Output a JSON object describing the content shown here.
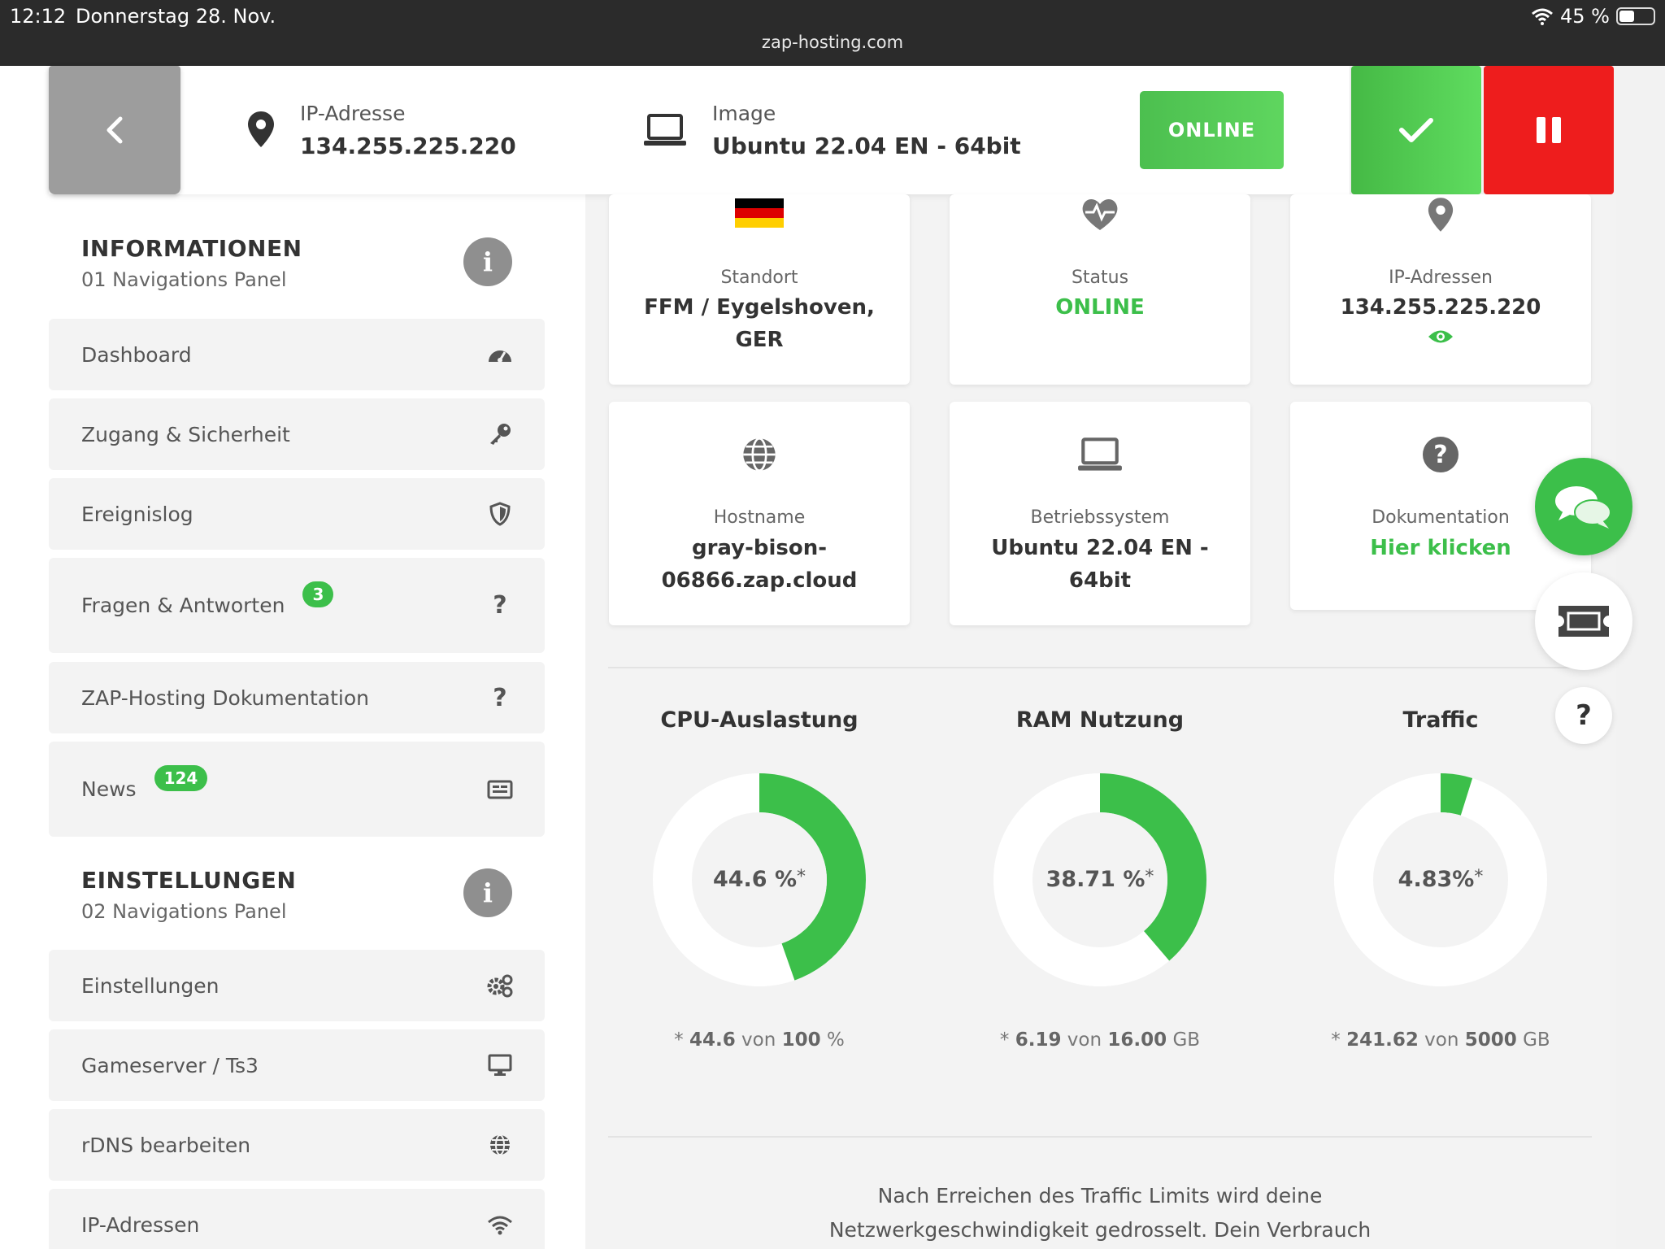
{
  "status_bar": {
    "time": "12:12",
    "date": "Donnerstag 28. Nov.",
    "url": "zap-hosting.com",
    "battery": "45 %",
    "battery_level": 0.45
  },
  "topbar": {
    "ip_label": "IP-Adresse",
    "ip_value": "134.255.225.220",
    "image_label": "Image",
    "image_value": "Ubuntu 22.04 EN - 64bit",
    "online_label": "ONLINE"
  },
  "sidebar": {
    "section1": {
      "title": "INFORMATIONEN",
      "subtitle": "01 Navigations Panel"
    },
    "section2": {
      "title": "EINSTELLUNGEN",
      "subtitle": "02 Navigations Panel"
    },
    "items": [
      {
        "label": "Dashboard",
        "icon": "speedometer-icon"
      },
      {
        "label": "Zugang & Sicherheit",
        "icon": "key-icon"
      },
      {
        "label": "Ereignislog",
        "icon": "shield-icon"
      },
      {
        "label": "Fragen & Antworten",
        "icon": "question-icon",
        "badge": "3"
      },
      {
        "label": "ZAP-Hosting Dokumentation",
        "icon": "question-icon"
      },
      {
        "label": "News",
        "icon": "newspaper-icon",
        "badge": "124"
      },
      {
        "label": "Einstellungen",
        "icon": "gears-icon"
      },
      {
        "label": "Gameserver / Ts3",
        "icon": "monitor-icon"
      },
      {
        "label": "rDNS bearbeiten",
        "icon": "globe-icon"
      },
      {
        "label": "IP-Adressen",
        "icon": "wifi-icon"
      }
    ]
  },
  "cards": {
    "standort": {
      "label": "Standort",
      "value": "FFM / Eygelshoven, GER",
      "icon": "german-flag-icon"
    },
    "status": {
      "label": "Status",
      "value": "ONLINE",
      "icon": "heartbeat-icon"
    },
    "ip": {
      "label": "IP-Adressen",
      "value": "134.255.225.220",
      "icon": "map-pin-icon"
    },
    "hostname": {
      "label": "Hostname",
      "value": "gray-bison-06866.zap.cloud",
      "icon": "globe-icon"
    },
    "os": {
      "label": "Betriebssystem",
      "value": "Ubuntu 22.04 EN - 64bit",
      "icon": "laptop-icon"
    },
    "docs": {
      "label": "Dokumentation",
      "value": "Hier klicken",
      "icon": "question-circle-icon"
    }
  },
  "gauges": [
    {
      "title": "CPU-Auslastung",
      "value_text": "44.6 %",
      "fraction": 0.446,
      "used": "44.6",
      "total": "100",
      "unit": "%"
    },
    {
      "title": "RAM Nutzung",
      "value_text": "38.71 %",
      "fraction": 0.3871,
      "used": "6.19",
      "total": "16.00",
      "unit": "GB"
    },
    {
      "title": "Traffic",
      "value_text": "4.83%",
      "fraction": 0.0483,
      "used": "241.62",
      "total": "5000",
      "unit": "GB"
    }
  ],
  "gauge_foot": {
    "prefix": "* ",
    "middle": " von "
  },
  "footer": {
    "line1": "Nach Erreichen des Traffic Limits wird deine",
    "line2": "Netzwerkgeschwindigkeit gedrosselt. Dein Verbrauch"
  },
  "colors": {
    "accent_green": "#3cbf4a",
    "danger_red": "#ee1d1d"
  }
}
